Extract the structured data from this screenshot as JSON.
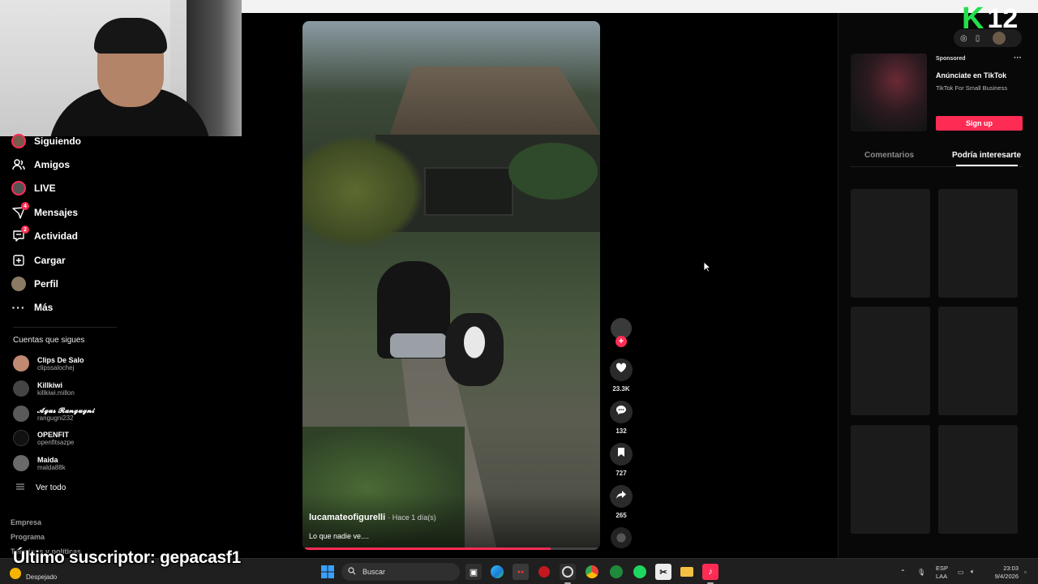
{
  "nav": {
    "items": [
      {
        "label": "Siguiendo",
        "icon": "following-avatar-icon"
      },
      {
        "label": "Amigos",
        "icon": "friends-icon"
      },
      {
        "label": "LIVE",
        "icon": "live-icon"
      },
      {
        "label": "Mensajes",
        "icon": "messages-icon",
        "badge": "4"
      },
      {
        "label": "Actividad",
        "icon": "activity-icon",
        "badge": "2"
      },
      {
        "label": "Cargar",
        "icon": "upload-icon"
      },
      {
        "label": "Perfil",
        "icon": "profile-avatar-icon"
      },
      {
        "label": "Más",
        "icon": "more-icon"
      }
    ]
  },
  "following": {
    "title": "Cuentas que sigues",
    "accounts": [
      {
        "name": "Clips De Salo",
        "handle": "clipssalochej"
      },
      {
        "name": "Killkiwi",
        "handle": "killkiwi.millon"
      },
      {
        "name": "𝓐𝓰𝓾𝓼 𝓡𝓪𝓷𝓰𝓾𝓰𝓷𝓲",
        "handle": "rangugni232"
      },
      {
        "name": "OPENFIT",
        "handle": "openfitsazpe"
      },
      {
        "name": "Maida",
        "handle": "malda88k"
      }
    ],
    "see_all": "Ver todo"
  },
  "footer_links": [
    "Empresa",
    "Programa",
    "Términos y políticas"
  ],
  "video": {
    "author": "lucamateofigurelli",
    "time": "· Hace 1 día(s)",
    "caption": "Lo que nadie ve....",
    "progress_fraction": 0.84
  },
  "actions": {
    "follow_symbol": "+",
    "likes": "23.3K",
    "comments": "132",
    "saves": "727",
    "shares": "265"
  },
  "ad": {
    "sponsored": "Sponsored",
    "more": "···",
    "title": "Anúnciate en TikTok",
    "subtitle": "TikTok For Small Business",
    "cta": "Sign up"
  },
  "right_tabs": {
    "comments": "Comentarios",
    "suggested": "Podría interesarte"
  },
  "brand": {
    "letter": "K",
    "number": "12",
    "color": "#22e04a"
  },
  "overlay": {
    "subscriber": "Último suscriptor: gepacasf1"
  },
  "taskbar": {
    "weather": "Despejado",
    "search_placeholder": "Buscar",
    "lang_line1": "ESP",
    "lang_line2": "LAA",
    "time": "23:03",
    "date": "9/4/2026"
  },
  "colors": {
    "accent": "#fe2c55",
    "background": "#000000",
    "panel": "#080808"
  }
}
